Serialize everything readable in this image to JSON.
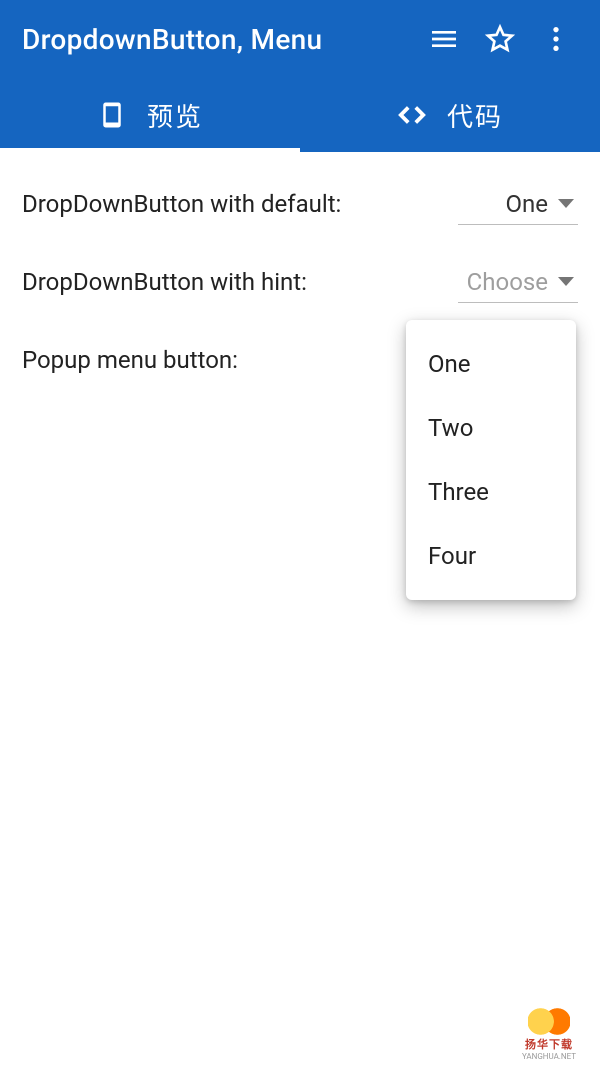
{
  "appbar": {
    "title": "DropdownButton, Menu"
  },
  "tabs": {
    "preview": "预览",
    "code": "代码"
  },
  "rows": {
    "default_label": "DropDownButton with default:",
    "default_value": "One",
    "hint_label": "DropDownButton with hint:",
    "hint_value": "Choose",
    "popup_label": "Popup menu button:"
  },
  "popup": {
    "items": [
      "One",
      "Two",
      "Three",
      "Four"
    ]
  },
  "watermark": {
    "line1": "扬华下载",
    "line2": "YANGHUA.NET"
  }
}
